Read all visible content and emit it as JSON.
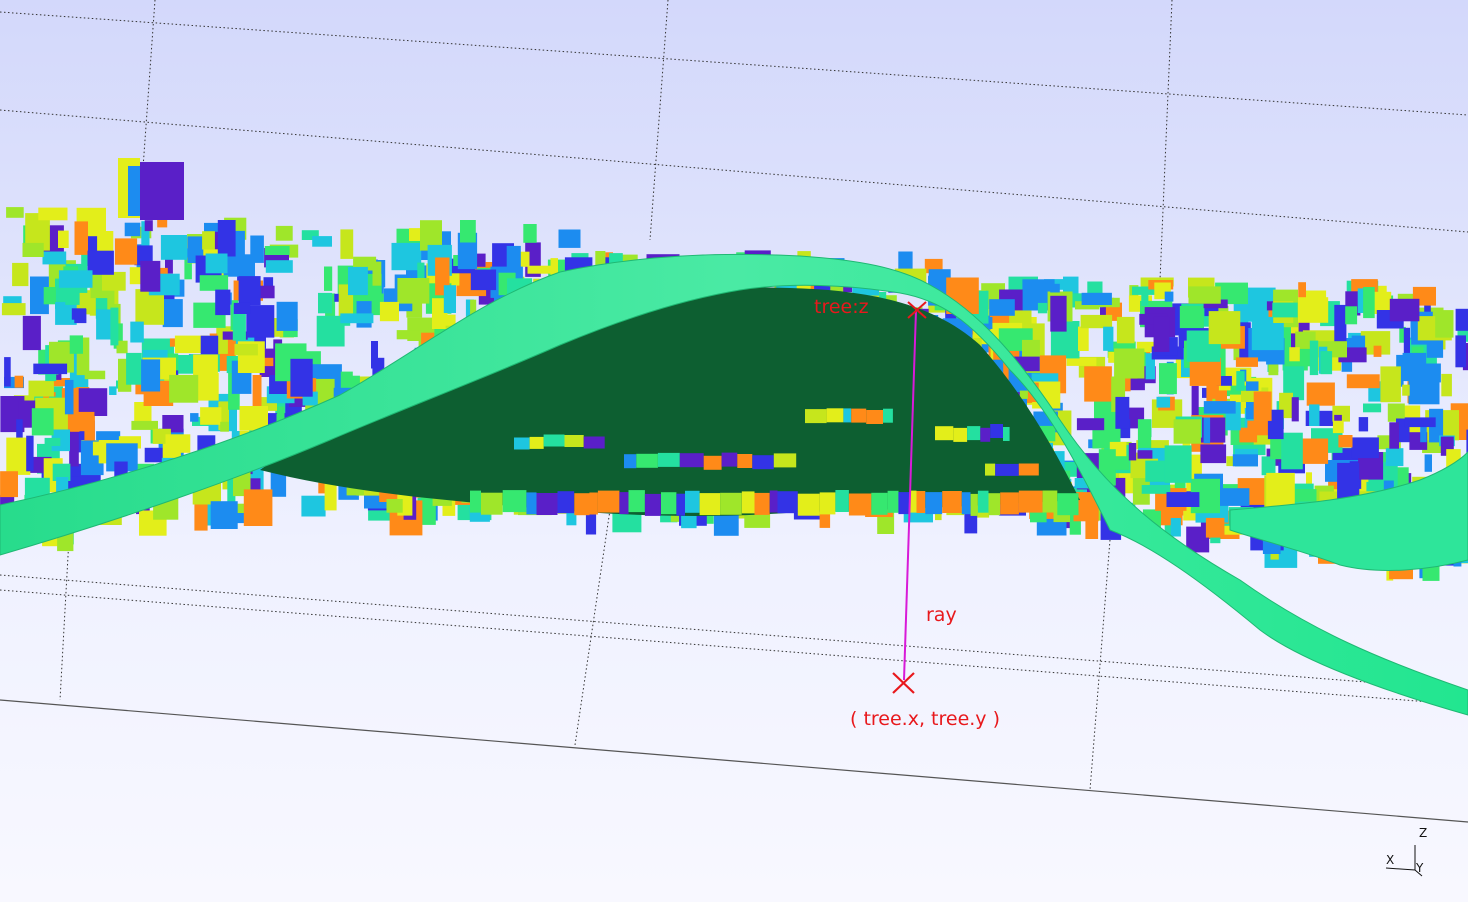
{
  "viewport": {
    "annotations": {
      "tree_z_label": "tree:z",
      "ray_label": "ray",
      "tree_xy_label": "( tree.x, tree.y )"
    },
    "axis_triad": {
      "x_label": "X",
      "y_label": "Y",
      "z_label": "Z"
    }
  },
  "colors": {
    "sky_top": "#d4d9fb",
    "sky_bottom": "#f4f5ff",
    "river_surface": "#2ee59a",
    "river_dark": "#0b5a2f",
    "ray": "#d81ad8",
    "marker": "#e8181c",
    "building_palette": [
      "#e3ee1a",
      "#c6e61c",
      "#9fe62a",
      "#36e870",
      "#1ec6e0",
      "#1c8cf0",
      "#3333e6",
      "#5a1fc8",
      "#24e0a0",
      "#ff8a18"
    ]
  }
}
